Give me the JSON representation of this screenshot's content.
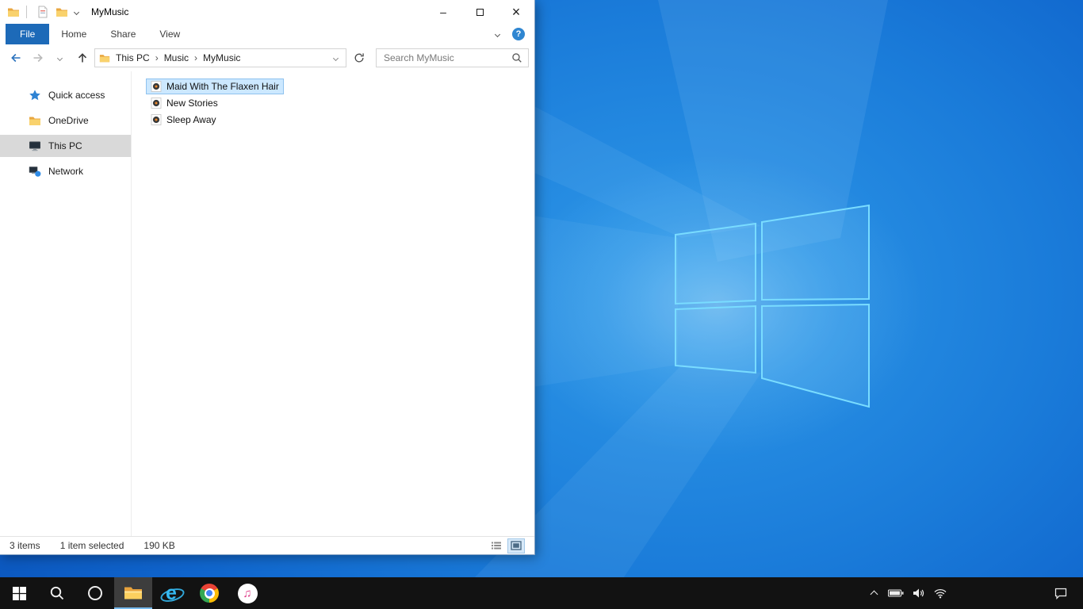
{
  "window": {
    "title": "MyMusic",
    "controls": {
      "minimize_glyph": "–",
      "close_glyph": "×"
    }
  },
  "ribbon": {
    "tabs": [
      {
        "label": "File"
      },
      {
        "label": "Home"
      },
      {
        "label": "Share"
      },
      {
        "label": "View"
      }
    ],
    "help_glyph": "?"
  },
  "address": {
    "crumbs": [
      "This PC",
      "Music",
      "MyMusic"
    ],
    "separator": "›"
  },
  "search": {
    "placeholder": "Search MyMusic"
  },
  "sidebar": {
    "items": [
      {
        "label": "Quick access",
        "icon": "star-icon",
        "selected": false
      },
      {
        "label": "OneDrive",
        "icon": "folder-icon",
        "selected": false
      },
      {
        "label": "This PC",
        "icon": "pc-icon",
        "selected": true
      },
      {
        "label": "Network",
        "icon": "network-icon",
        "selected": false
      }
    ]
  },
  "files": [
    {
      "name": "Maid With The Flaxen Hair",
      "icon": "music-file-icon",
      "selected": true
    },
    {
      "name": "New Stories",
      "icon": "music-file-icon",
      "selected": false
    },
    {
      "name": "Sleep Away",
      "icon": "music-file-icon",
      "selected": false
    }
  ],
  "status_bar": {
    "count": "3 items",
    "selection": "1 item selected",
    "size": "190 KB"
  },
  "taskbar": {
    "apps": [
      "start",
      "search",
      "cortana",
      "file-explorer",
      "internet-explorer",
      "chrome",
      "itunes"
    ],
    "active_app": "file-explorer",
    "ie_glyph": "e",
    "itunes_glyph": "♫",
    "tray": [
      "hidden-icons-chevron",
      "battery",
      "volume",
      "network",
      "action-center"
    ]
  },
  "colors": {
    "accent_blue": "#1d6ab8",
    "selection_fill": "#cce8ff",
    "selection_border": "#8fc2ef",
    "sidebar_selected": "#d9d9d9",
    "taskbar_bg": "#121212",
    "wallpaper_blue": "#0f64cc"
  }
}
